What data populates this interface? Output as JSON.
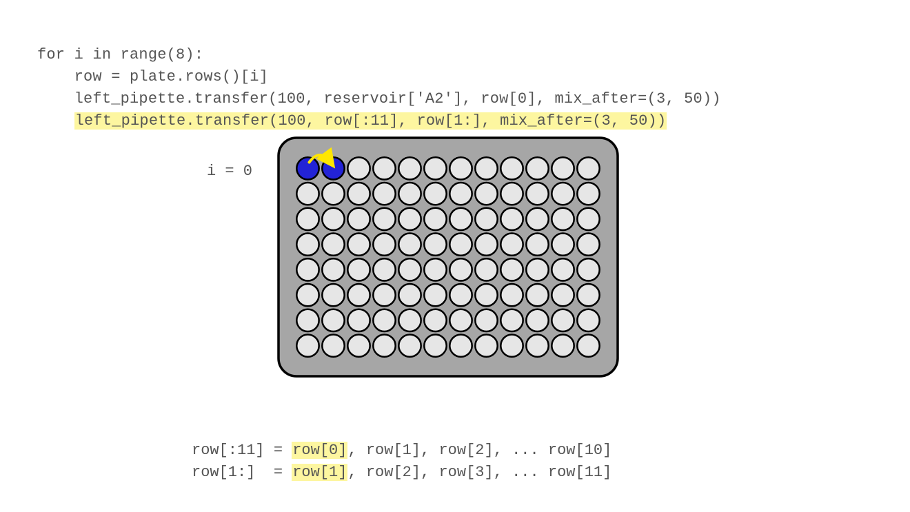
{
  "code": {
    "line1": "for i in range(8):",
    "line2": "    row = plate.rows()[i]",
    "line3": "    left_pipette.transfer(100, reservoir['A2'], row[0], mix_after=(3, 50))",
    "line4": "    ",
    "line4_hl": "left_pipette.transfer(100, row[:11], row[1:], mix_after=(3, 50))"
  },
  "iteration_label": "i = 0",
  "plate": {
    "rows": 8,
    "cols": 12,
    "active_row": 0,
    "filled_cols": [
      0,
      1
    ],
    "arrow_from_col": 0,
    "arrow_to_col": 1,
    "well_fill_empty": "#e6e6e6",
    "well_fill_active": "#2323d6",
    "plate_fill": "#a6a6a6",
    "plate_stroke": "#000000",
    "arrow_color": "#ffe600"
  },
  "footer": {
    "l1_pre": "row[:11] = ",
    "l1_hl": "row[0]",
    "l1_post": ", row[1], row[2], ... row[10]",
    "l2_pre": "row[1:]  = ",
    "l2_hl": "row[1]",
    "l2_post": ", row[2], row[3], ... row[11]"
  }
}
